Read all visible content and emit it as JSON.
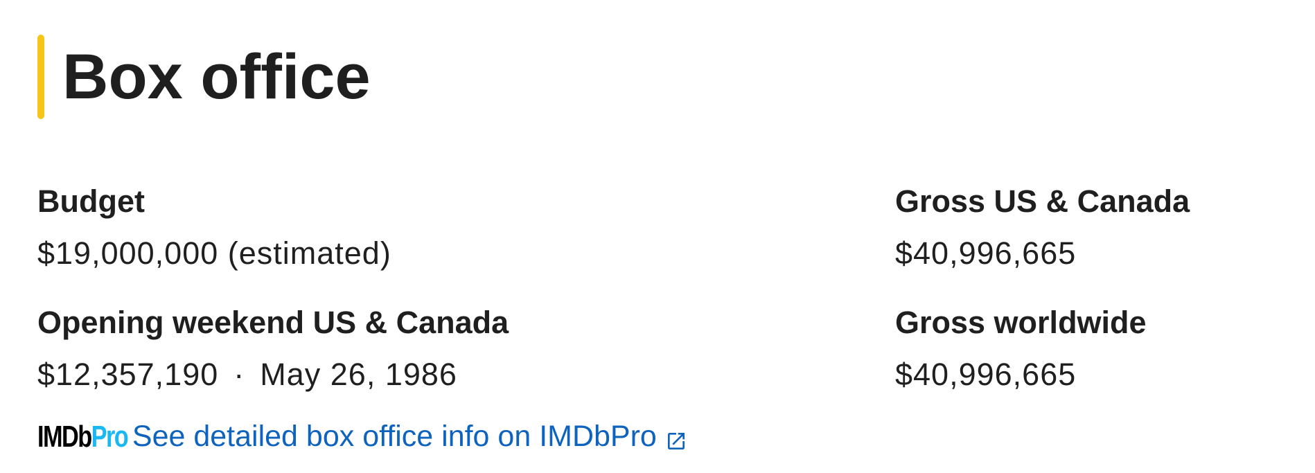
{
  "section": {
    "title": "Box office"
  },
  "left_items": [
    {
      "label": "Budget",
      "value": "$19,000,000 (estimated)"
    },
    {
      "label": "Opening weekend US & Canada",
      "value": "$12,357,190",
      "separator": "·",
      "date": "May 26, 1986"
    }
  ],
  "right_items": [
    {
      "label": "Gross US & Canada",
      "value": "$40,996,665"
    },
    {
      "label": "Gross worldwide",
      "value": "$40,996,665"
    }
  ],
  "imdbpro": {
    "logo_part1": "IMDb",
    "logo_part2": "Pro",
    "link_text": "See detailed box office info on IMDbPro",
    "icon": "external-link-icon"
  },
  "colors": {
    "accent_bar": "#f5c518",
    "text": "#1f1f1f",
    "link": "#0e63be",
    "pro_blue": "#1ab8f3"
  }
}
